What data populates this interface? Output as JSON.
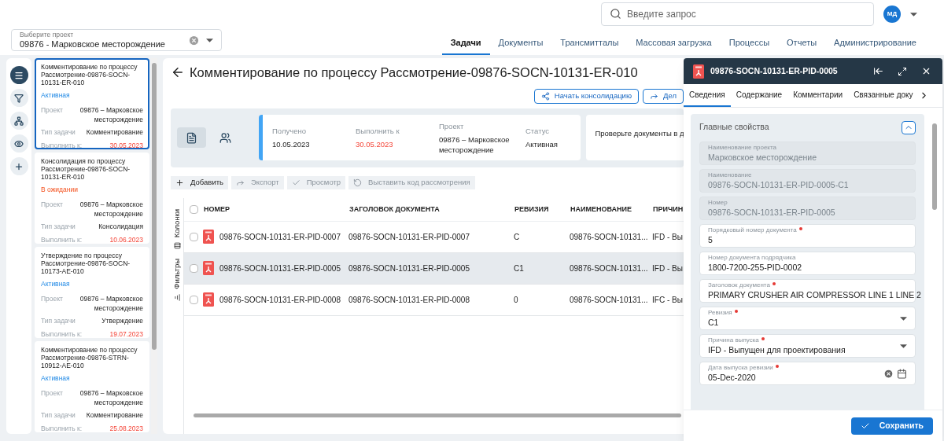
{
  "header": {
    "search": {
      "placeholder": "Введите запрос"
    },
    "user": {
      "initials": "МД"
    }
  },
  "project_select": {
    "label": "Выберите проект",
    "value": "09876 - Марковское месторождение"
  },
  "nav_tabs": [
    {
      "label": "Задачи",
      "selected": true
    },
    {
      "label": "Документы",
      "selected": false
    },
    {
      "label": "Трансмитталы",
      "selected": false
    },
    {
      "label": "Массовая загрузка",
      "selected": false
    },
    {
      "label": "Процессы",
      "selected": false
    },
    {
      "label": "Отчеты",
      "selected": false
    },
    {
      "label": "Администрирование",
      "selected": false
    }
  ],
  "rail": [
    {
      "kind": "menu",
      "selected": true
    },
    {
      "kind": "filter",
      "selected": false
    },
    {
      "kind": "tree",
      "selected": false
    },
    {
      "kind": "view",
      "selected": false
    },
    {
      "kind": "add",
      "selected": false
    }
  ],
  "tasks": [
    {
      "title": "Комментирование по процессу Рассмотрение-09876-SOCN-10131-ER-010",
      "status": "Активная",
      "pending": false,
      "selected": true,
      "fields": [
        {
          "label": "Проект",
          "value": "09876 – Марковское месторождение",
          "overdue": false
        },
        {
          "label": "Тип задачи",
          "value": "Комментирование",
          "overdue": false
        },
        {
          "label": "Выполнить к:",
          "value": "30.05.2023",
          "overdue": true
        }
      ]
    },
    {
      "title": "Консолидация по процессу Рассмотрение-09876-SOCN-10131-ER-010",
      "status": "В ожидании",
      "pending": true,
      "selected": false,
      "fields": [
        {
          "label": "Проект",
          "value": "09876 – Марковское месторождение",
          "overdue": false
        },
        {
          "label": "Тип задачи",
          "value": "Консолидация",
          "overdue": false
        },
        {
          "label": "Выполнить к:",
          "value": "10.06.2023",
          "overdue": true
        }
      ]
    },
    {
      "title": "Утверждение по процессу Рассмотрение-09876-SOCN-10173-AE-010",
      "status": "Активная",
      "pending": false,
      "selected": false,
      "fields": [
        {
          "label": "Проект",
          "value": "09876 – Марковское месторождение",
          "overdue": false
        },
        {
          "label": "Тип задачи",
          "value": "Утверждение",
          "overdue": false
        },
        {
          "label": "Выполнить к:",
          "value": "19.07.2023",
          "overdue": true
        }
      ]
    },
    {
      "title": "Комментирование по процессу Рассмотрение-09876-STRN-10912-AE-010",
      "status": "Активная",
      "pending": false,
      "selected": false,
      "fields": [
        {
          "label": "Проект",
          "value": "09876 – Марковское месторождение",
          "overdue": false
        },
        {
          "label": "Тип задачи",
          "value": "Комментирование",
          "overdue": false
        },
        {
          "label": "Выполнить к:",
          "value": "25.08.2023",
          "overdue": true
        }
      ]
    }
  ],
  "task": {
    "title": "Комментирование по процессу Рассмотрение-09876-SOCN-10131-ER-010",
    "actions": [
      {
        "label": "Начать консолидацию",
        "kind": "consolidate"
      },
      {
        "label": "Дел",
        "kind": "delegate"
      }
    ],
    "view_tabs": [
      {
        "kind": "document",
        "selected": true
      },
      {
        "kind": "people",
        "selected": false
      }
    ],
    "info": [
      {
        "label": "Получено",
        "value": "10.05.2023",
        "overdue": false
      },
      {
        "label": "Выполнить к",
        "value": "30.05.2023",
        "overdue": true
      },
      {
        "label": "Проект",
        "value": "09876 – Марковское месторождение",
        "overdue": false
      },
      {
        "label": "Статус",
        "value": "Активная",
        "overdue": false
      }
    ],
    "note": "Проверьте документы в д"
  },
  "toolbar": [
    {
      "label": "Добавить",
      "kind": "add",
      "disabled": false
    },
    {
      "label": "Экспорт",
      "kind": "export",
      "disabled": true
    },
    {
      "label": "Просмотр",
      "kind": "review",
      "disabled": true
    },
    {
      "label": "Выставить код рассмотрения",
      "kind": "code",
      "disabled": true
    }
  ],
  "side_tabs": [
    {
      "label": "Колонки",
      "kind": "columns"
    },
    {
      "label": "Фильтры",
      "kind": "filters"
    }
  ],
  "table": {
    "all_checked": false,
    "columns": [
      "НОМЕР",
      "ЗАГОЛОВОК ДОКУМЕНТА",
      "РЕВИЗИЯ",
      "НАИМЕНОВАНИЕ",
      "ПРИЧИН"
    ],
    "rows": [
      {
        "selected": false,
        "checked": false,
        "cells": [
          "09876-SOCN-10131-ER-PID-0007",
          "09876-SOCN-10131-ER-PID-0007",
          "C",
          "09876-SOCN-10131...",
          "IFD - Вы"
        ]
      },
      {
        "selected": true,
        "checked": false,
        "cells": [
          "09876-SOCN-10131-ER-PID-0005",
          "09876-SOCN-10131-ER-PID-0005",
          "C1",
          "09876-SOCN-10131...",
          "IFD - Вы"
        ]
      },
      {
        "selected": false,
        "checked": false,
        "cells": [
          "09876-SOCN-10131-ER-PID-0008",
          "09876-SOCN-10131-ER-PID-0008",
          "0",
          "09876-SOCN-10131...",
          "IFC - Вы"
        ]
      }
    ]
  },
  "drawer": {
    "title": "09876-SOCN-10131-ER-PID-0005",
    "tabs": [
      {
        "label": "Сведения",
        "selected": true
      },
      {
        "label": "Содержание",
        "selected": false
      },
      {
        "label": "Комментарии",
        "selected": false
      },
      {
        "label": "Связанные доку",
        "selected": false
      }
    ],
    "section": {
      "title": "Главные свойства",
      "expanded": true,
      "fields": [
        {
          "label": "Наименование проекта",
          "value": "Марковское месторождение",
          "kind": "text",
          "disabled": true,
          "required": false
        },
        {
          "label": "Наименование",
          "value": "09876-SOCN-10131-ER-PID-0005-C1",
          "kind": "text",
          "disabled": true,
          "required": false
        },
        {
          "label": "Номер",
          "value": "09876-SOCN-10131-ER-PID-0005",
          "kind": "text",
          "disabled": true,
          "required": false
        },
        {
          "label": "Порядковый номер документа",
          "value": "5",
          "kind": "text",
          "disabled": false,
          "required": true
        },
        {
          "label": "Номер документа подрядчика",
          "value": "1800-7200-255-PID-0002",
          "kind": "text",
          "disabled": false,
          "required": false
        },
        {
          "label": "Заголовок документа",
          "value": "PRIMARY CRUSHER AIR COMPRESSOR LINE 1  LINE 2",
          "kind": "text",
          "disabled": false,
          "required": true
        },
        {
          "label": "Ревизия",
          "value": "C1",
          "kind": "select",
          "disabled": false,
          "required": true
        },
        {
          "label": "Причина выпуска",
          "value": "IFD - Выпущен для проектирования",
          "kind": "select",
          "disabled": false,
          "required": true
        },
        {
          "label": "Дата выпуска ревизии",
          "value": "05-Dec-2020",
          "kind": "date",
          "disabled": false,
          "required": true
        }
      ]
    },
    "save": "Сохранить"
  }
}
